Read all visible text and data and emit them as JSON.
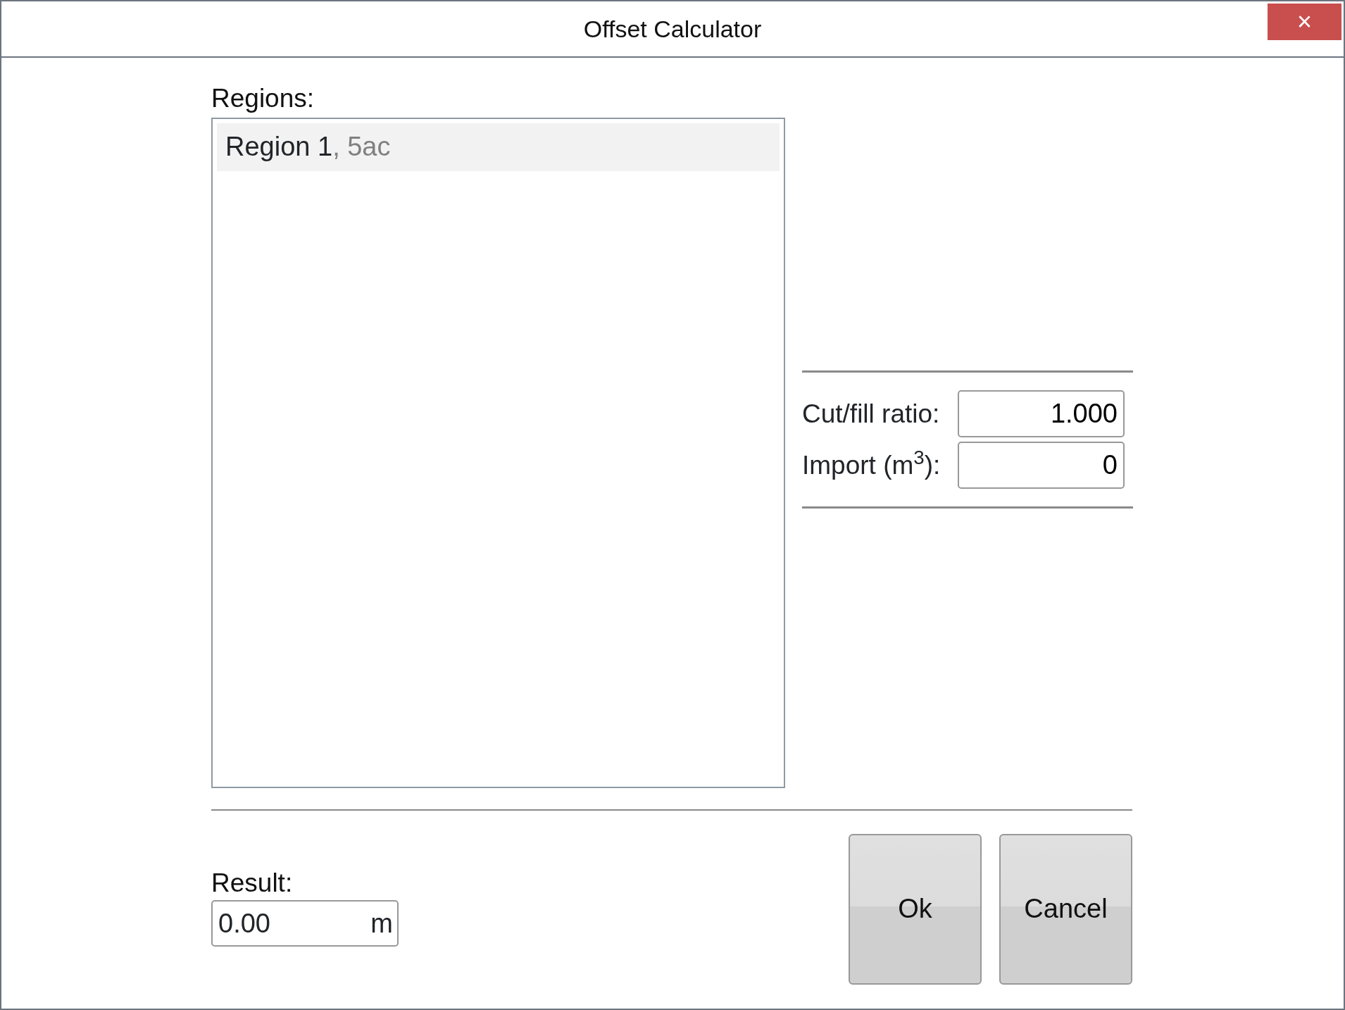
{
  "window": {
    "title": "Offset Calculator",
    "close": "×"
  },
  "regions": {
    "label": "Regions:",
    "items": [
      {
        "name": "Region 1",
        "detail": ", 5ac",
        "selected": true
      }
    ]
  },
  "fields": [
    {
      "label": "Cut/fill ratio:",
      "value": "1.000"
    },
    {
      "label": "Import (m$^{3}$):",
      "value": "0"
    }
  ],
  "result": {
    "label": "Result:",
    "value": "0.00",
    "unit": "m"
  },
  "buttons": [
    "Ok",
    "Cancel"
  ]
}
